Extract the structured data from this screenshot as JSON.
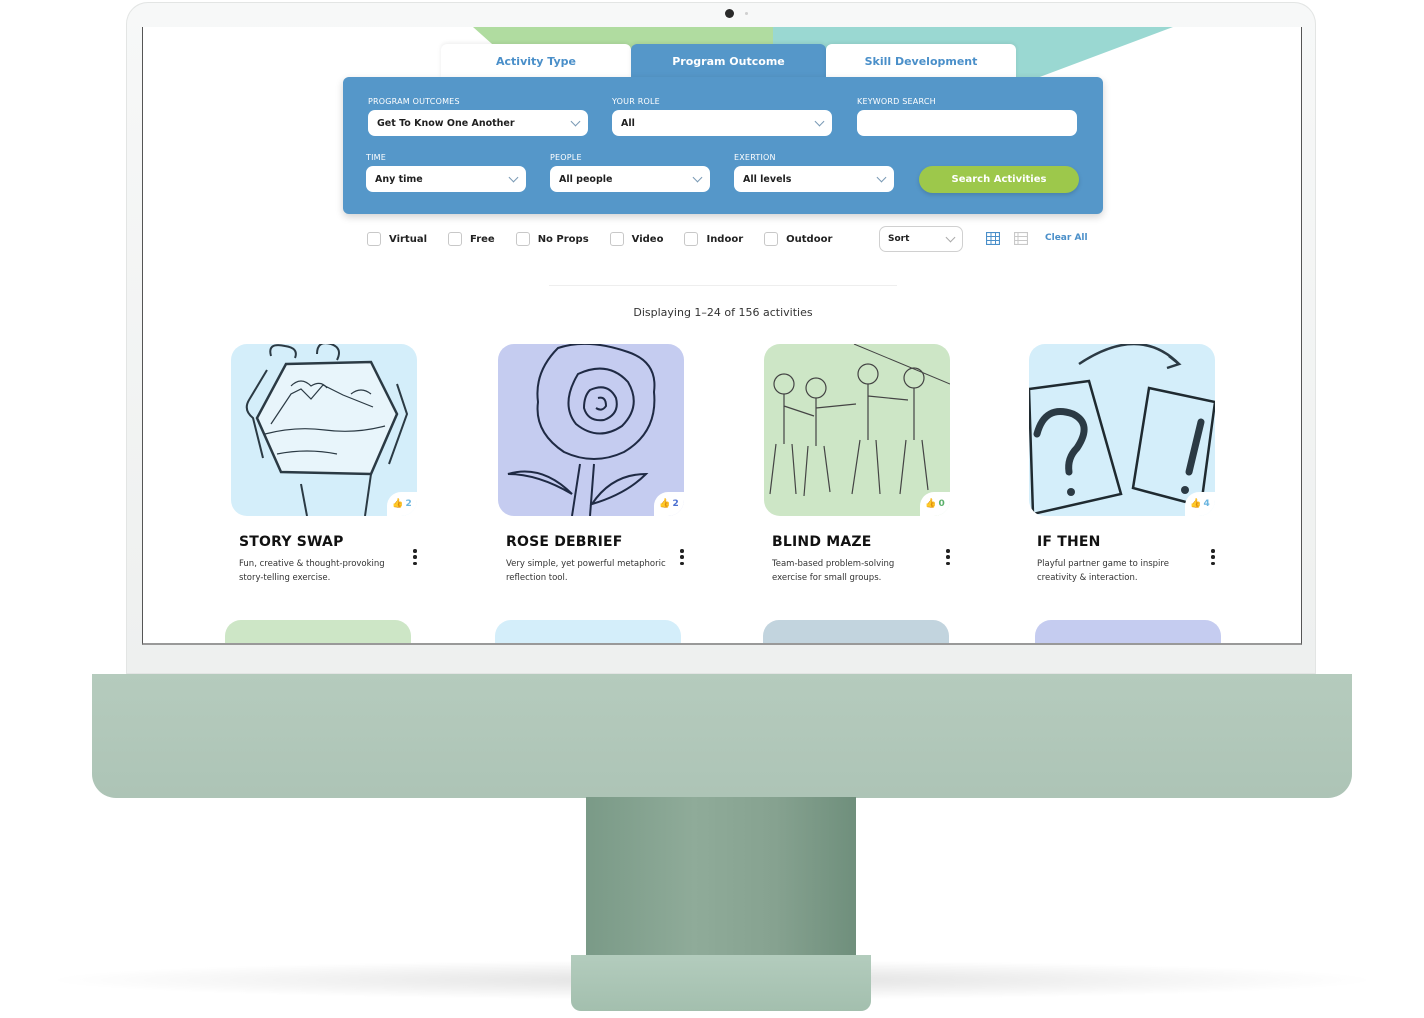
{
  "tabs": [
    {
      "label": "Activity Type",
      "active": false
    },
    {
      "label": "Program Outcome",
      "active": true
    },
    {
      "label": "Skill Development",
      "active": false
    }
  ],
  "filters": {
    "program_outcomes": {
      "label": "PROGRAM OUTCOMES",
      "value": "Get To Know One Another"
    },
    "your_role": {
      "label": "YOUR ROLE",
      "value": "All"
    },
    "keyword_search": {
      "label": "KEYWORD SEARCH",
      "value": "",
      "placeholder": ""
    },
    "time": {
      "label": "TIME",
      "value": "Any time"
    },
    "people": {
      "label": "PEOPLE",
      "value": "All people"
    },
    "exertion": {
      "label": "EXERTION",
      "value": "All levels"
    },
    "search_button": "Search Activities"
  },
  "checkboxes": [
    {
      "label": "Virtual",
      "checked": false
    },
    {
      "label": "Free",
      "checked": false
    },
    {
      "label": "No Props",
      "checked": false
    },
    {
      "label": "Video",
      "checked": false
    },
    {
      "label": "Indoor",
      "checked": false
    },
    {
      "label": "Outdoor",
      "checked": false
    }
  ],
  "toolbar": {
    "sort_label": "Sort",
    "view_grid_icon": "grid-view-icon",
    "view_list_icon": "list-view-icon",
    "clear_all": "Clear All"
  },
  "results": {
    "count_text": "Displaying 1–24 of 156 activities"
  },
  "cards": [
    {
      "title": "STORY SWAP",
      "description": "Fun, creative & thought-provoking story-telling exercise.",
      "likes": "2",
      "liked": true,
      "image": "hands-holding-landscape",
      "bg": "#d4eefa",
      "like_color": "#6ab5e0"
    },
    {
      "title": "ROSE DEBRIEF",
      "description": "Very simple, yet powerful metaphoric reflection tool.",
      "likes": "2",
      "liked": true,
      "image": "rose-line-drawing",
      "bg": "#c5ccf0",
      "like_color": "#4a6fd0"
    },
    {
      "title": "BLIND MAZE",
      "description": "Team-based problem-solving exercise for small groups.",
      "likes": "0",
      "liked": false,
      "image": "children-walking-line",
      "bg": "#cde6c6",
      "like_color": "#5ab06a"
    },
    {
      "title": "IF THEN",
      "description": "Playful partner game to inspire creativity & interaction.",
      "likes": "4",
      "liked": false,
      "image": "question-exclamation-cards",
      "bg": "#d4eefa",
      "like_color": "#6ab5e0"
    }
  ],
  "row2_cards": [
    {
      "bg": "#cde6c6"
    },
    {
      "bg": "#d4eefa"
    },
    {
      "bg": "#c2d4de"
    },
    {
      "bg": "#c5ccf0"
    }
  ],
  "colors": {
    "primary_blue": "#5597c9",
    "accent_green": "#9dc84b",
    "link_blue": "#4a8fc9"
  }
}
